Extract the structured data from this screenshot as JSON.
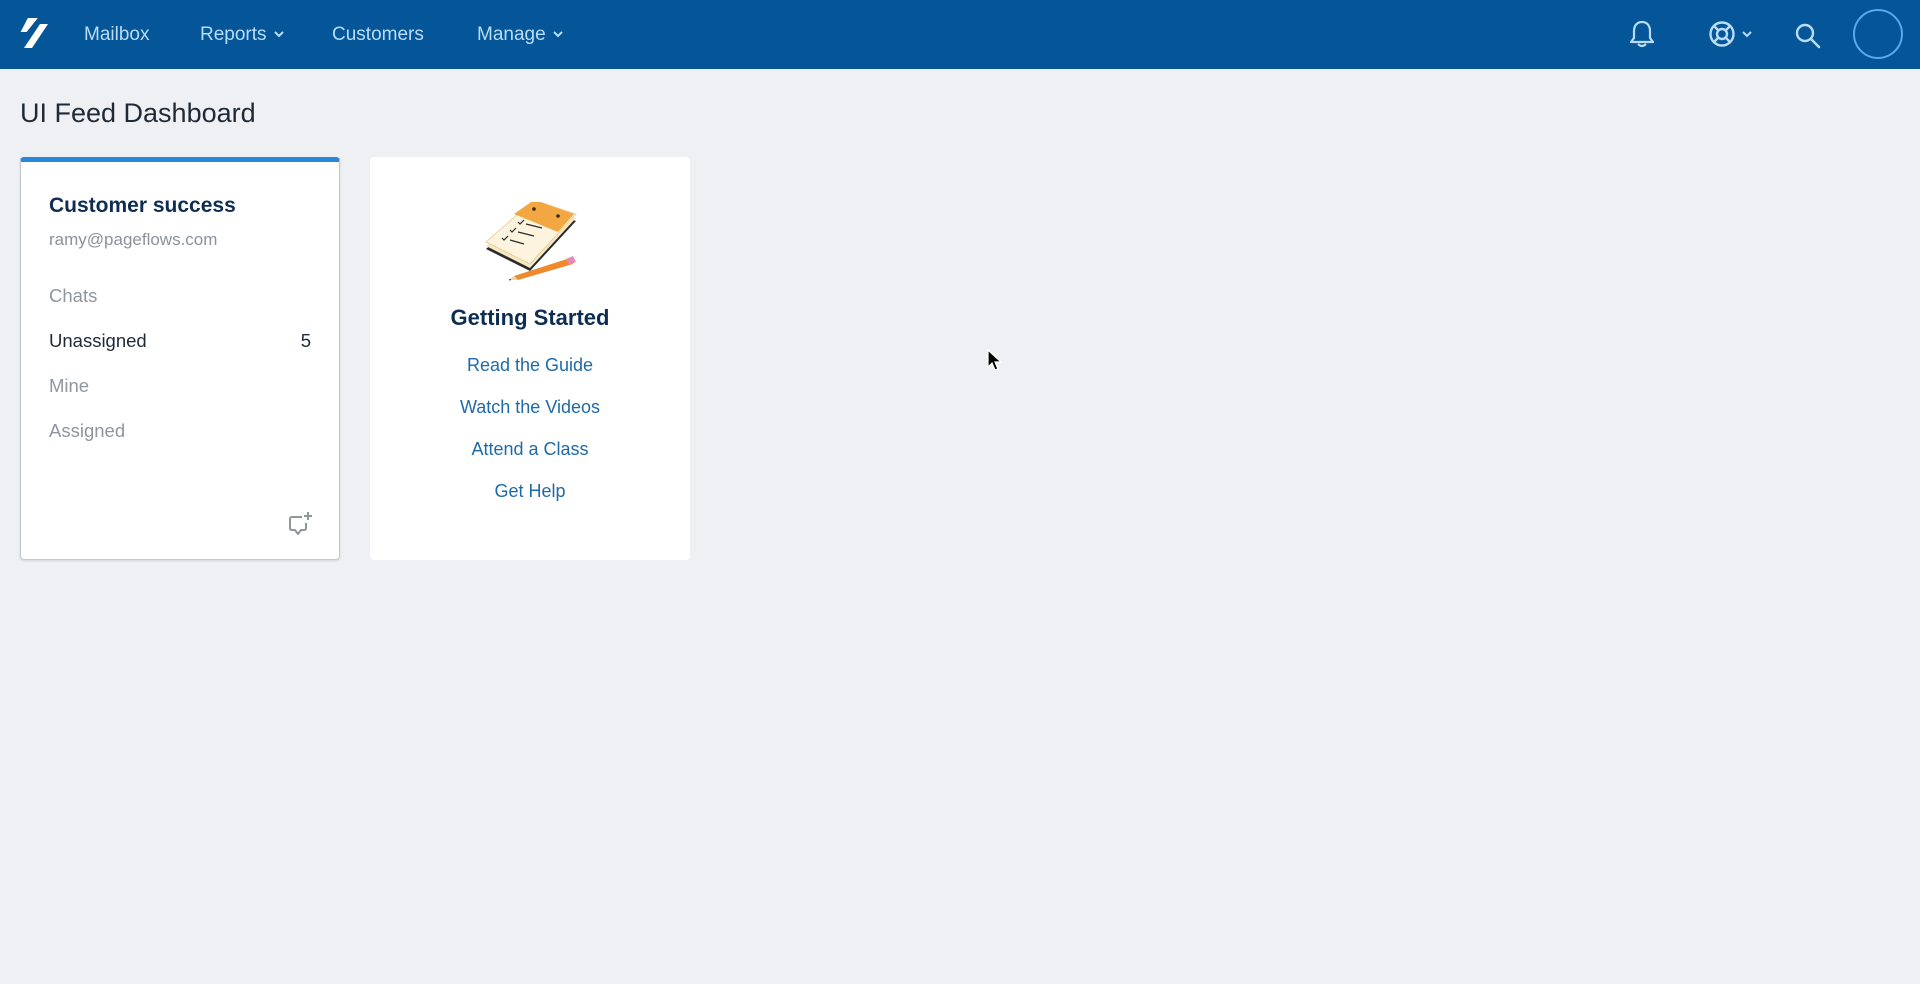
{
  "topbar": {
    "brand_color": "#055599",
    "nav": [
      {
        "label": "Mailbox",
        "has_dropdown": false
      },
      {
        "label": "Reports",
        "has_dropdown": true
      },
      {
        "label": "Customers",
        "has_dropdown": false
      },
      {
        "label": "Manage",
        "has_dropdown": true
      }
    ],
    "right_icons": [
      "bell-icon",
      "help-lifebuoy-icon",
      "search-icon",
      "avatar"
    ]
  },
  "page": {
    "title": "UI Feed Dashboard"
  },
  "mailbox_card": {
    "accent_color": "#2a86d8",
    "title": "Customer success",
    "email": "ramy@pageflows.com",
    "folders": [
      {
        "label": "Chats",
        "count": "",
        "active": false
      },
      {
        "label": "Unassigned",
        "count": "5",
        "active": true
      },
      {
        "label": "Mine",
        "count": "",
        "active": false
      },
      {
        "label": "Assigned",
        "count": "",
        "active": false
      }
    ]
  },
  "getting_started": {
    "title": "Getting Started",
    "links": [
      {
        "label": "Read the Guide"
      },
      {
        "label": "Watch the Videos"
      },
      {
        "label": "Attend a Class"
      },
      {
        "label": "Get Help"
      }
    ]
  }
}
